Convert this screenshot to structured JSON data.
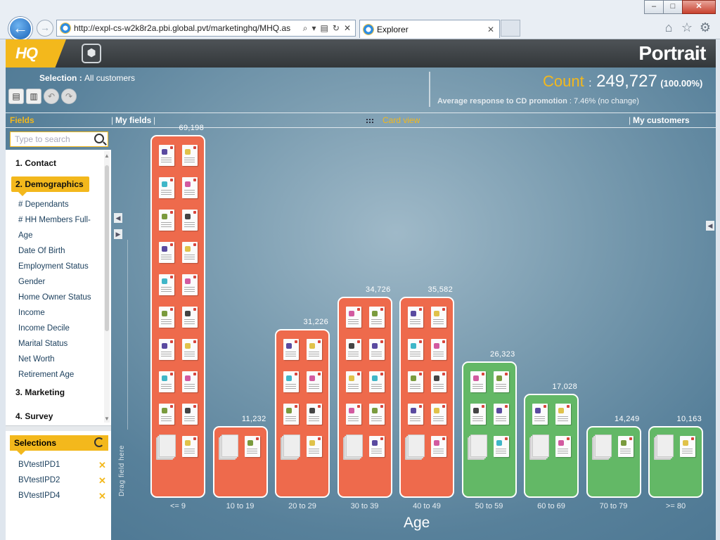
{
  "browser": {
    "url": "http://expl-cs-w2k8r2a.pbi.global.pvt/marketinghq/MHQ.as",
    "tab_title": "Explorer",
    "min": "–",
    "max": "□",
    "close": "✕"
  },
  "app": {
    "logo": "HQ",
    "brand": "Portrait"
  },
  "selection": {
    "label": "Selection",
    "value": "All customers"
  },
  "count": {
    "label": "Count",
    "value": "249,727",
    "percent": "(100.00%)"
  },
  "average": {
    "label": "Average response to CD promotion",
    "value": "7.46% (no change)"
  },
  "fields_bar": {
    "fields": "Fields",
    "my_fields": "My fields",
    "card_view": "Card view",
    "my_customers": "My customers"
  },
  "search": {
    "placeholder": "Type to search"
  },
  "categories": [
    "1. Contact",
    "2. Demographics",
    "3. Marketing",
    "4. Survey"
  ],
  "demographic_fields": [
    "# Dependants",
    "# HH Members Full-",
    "Age",
    "Date Of Birth",
    "Employment Status",
    "Gender",
    "Home Owner Status",
    "Income",
    "Income Decile",
    "Marital Status",
    "Net Worth",
    "Retirement Age"
  ],
  "selections": {
    "header": "Selections",
    "items": [
      "BVtestIPD1",
      "BVtestIPD2",
      "BVtestIPD4"
    ]
  },
  "drag_hint": "Drag field here",
  "colors": {
    "accent": "#f3b81c",
    "bar_orange": "#ee6a4c",
    "bar_green": "#63b866"
  },
  "chart_data": {
    "type": "bar",
    "xlabel": "Age",
    "categories": [
      "<= 9",
      "10 to 19",
      "20 to 29",
      "30 to 39",
      "40 to 49",
      "50 to 59",
      "60 to 69",
      "70 to 79",
      ">= 80"
    ],
    "values": [
      69198,
      11232,
      31226,
      34726,
      35582,
      26323,
      17028,
      14249,
      10163
    ],
    "value_labels": [
      "69,198",
      "11,232",
      "31,226",
      "34,726",
      "35,582",
      "26,323",
      "17,028",
      "14,249",
      "10,163"
    ],
    "bar_colors": [
      "orange",
      "orange",
      "orange",
      "orange",
      "orange",
      "green",
      "green",
      "green",
      "green"
    ]
  }
}
